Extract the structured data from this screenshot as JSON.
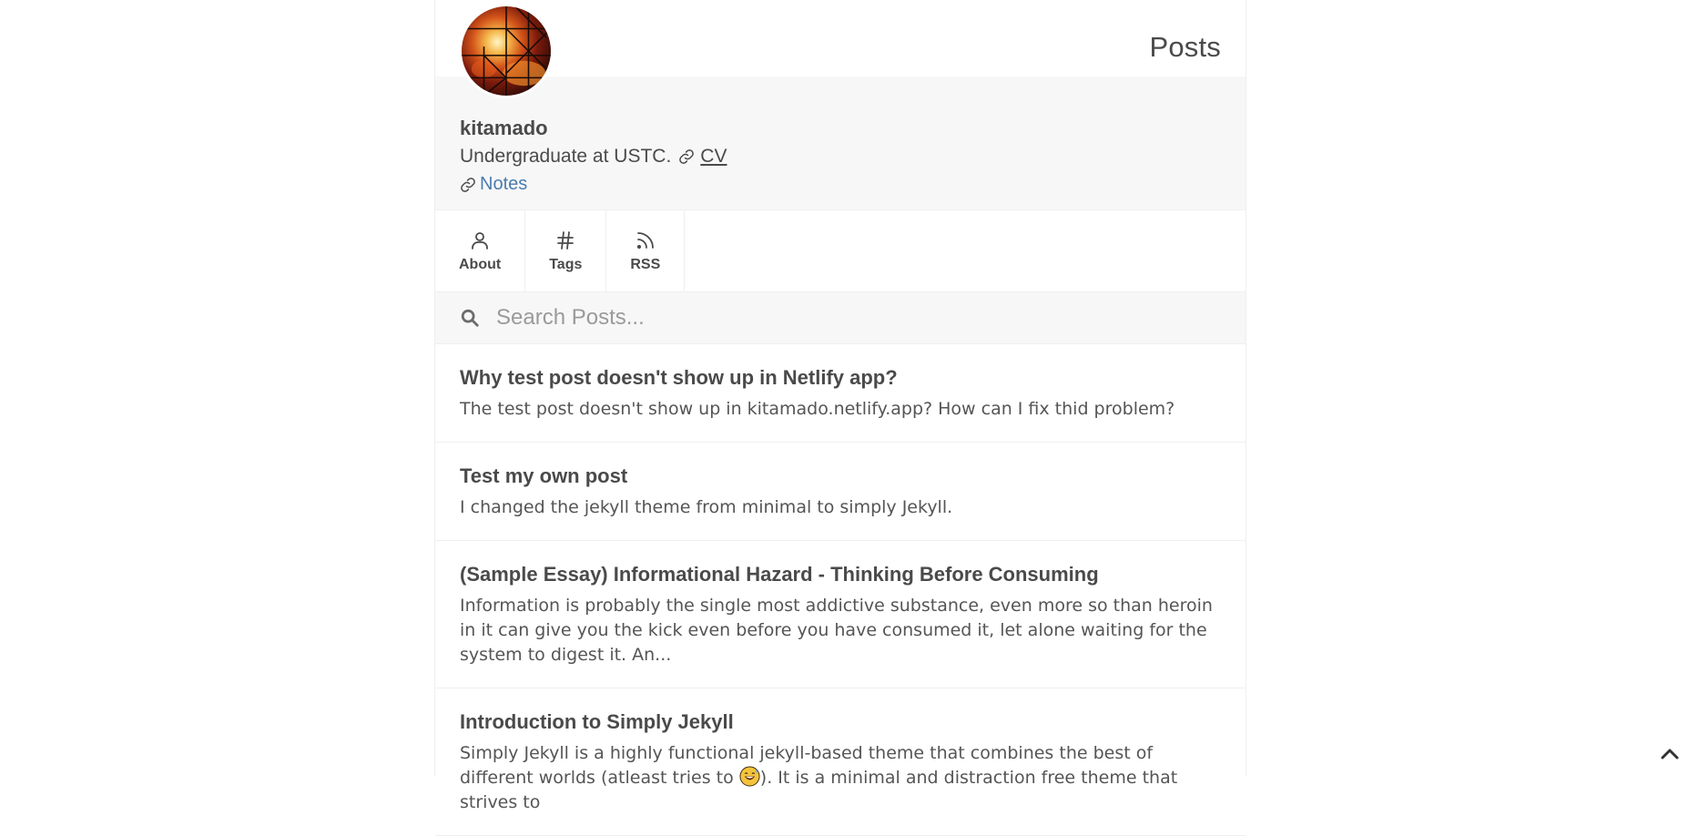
{
  "page": {
    "title": "Posts"
  },
  "profile": {
    "avatar_alt": "avatar",
    "name": "kitamado",
    "bio": "Undergraduate at USTC.",
    "cv_label": "CV",
    "notes_label": "Notes"
  },
  "nav": {
    "items": [
      {
        "label": "About",
        "icon": "person-icon"
      },
      {
        "label": "Tags",
        "icon": "hash-icon"
      },
      {
        "label": "RSS",
        "icon": "rss-icon"
      }
    ]
  },
  "search": {
    "placeholder": "Search Posts..."
  },
  "posts": [
    {
      "title": "Why test post doesn't show up in Netlify app?",
      "excerpt": "The test post doesn't show up in kitamado.netlify.app? How can I fix thid problem?"
    },
    {
      "title": "Test my own post",
      "excerpt": "I changed the jekyll theme from minimal to simply Jekyll."
    },
    {
      "title": "(Sample Essay) Informational Hazard - Thinking Before Consuming",
      "excerpt": "Information is probably the single most addictive substance, even more so than heroin in it can give you the kick even before you have consumed it, let alone waiting for the system to digest it. An..."
    },
    {
      "title": "Introduction to Simply Jekyll",
      "excerpt_before": "Simply Jekyll is a highly functional jekyll-based theme that combines the best of different worlds (atleast tries to ",
      "excerpt_after": "). It is a minimal and distraction free theme that strives to"
    }
  ],
  "colors": {
    "text": "#4a4a4a",
    "link": "#4a7cb0",
    "panel_bg": "#f7f7f7",
    "border": "#efefef"
  }
}
